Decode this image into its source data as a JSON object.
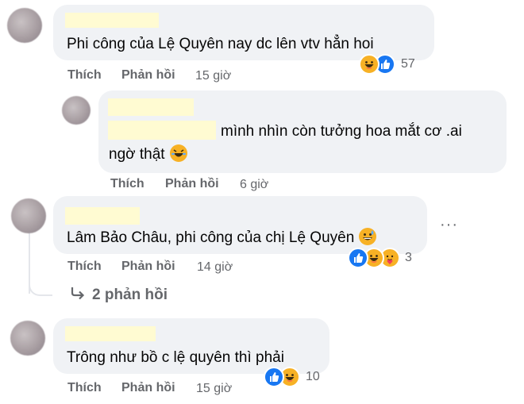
{
  "comments": [
    {
      "text": "Phi công của Lệ Quyên nay dc lên vtv hẳn hoi",
      "like": "Thích",
      "reply": "Phản hồi",
      "time": "15 giờ",
      "reaction_count": "57",
      "reactions": [
        "haha",
        "like"
      ]
    },
    {
      "text_line1": "mình nhìn còn tưởng hoa mắt cơ .ai",
      "text_line2": "ngờ thật",
      "like": "Thích",
      "reply": "Phản hồi",
      "time": "6 giờ"
    },
    {
      "text": "Lâm Bảo Châu, phi công của chị Lệ Quyên",
      "like": "Thích",
      "reply": "Phản hồi",
      "time": "14 giờ",
      "reaction_count": "3",
      "reactions": [
        "like",
        "haha",
        "care"
      ],
      "view_replies": "2 phản hồi"
    },
    {
      "text": "Trông như bồ c lệ quyên thì phải",
      "like": "Thích",
      "reply": "Phản hồi",
      "time": "15 giờ",
      "reaction_count": "10",
      "reactions": [
        "like",
        "haha"
      ]
    }
  ],
  "more_options": "···",
  "colors": {
    "bubble": "#f0f2f5",
    "secondary_text": "#65676b",
    "like_blue": "#1877f2",
    "haha_yellow": "#f7b125"
  }
}
